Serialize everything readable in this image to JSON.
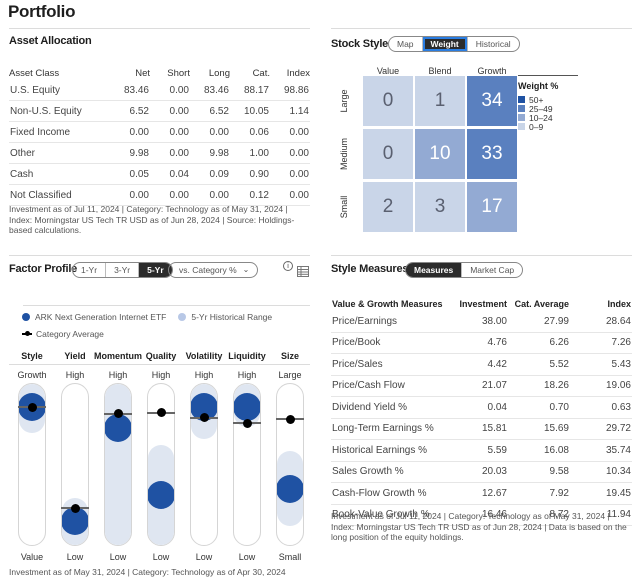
{
  "page_title": "Portfolio",
  "asset_allocation": {
    "title": "Asset Allocation",
    "columns": [
      "Asset Class",
      "Net",
      "Short",
      "Long",
      "Cat.",
      "Index"
    ],
    "rows": [
      [
        "U.S. Equity",
        "83.46",
        "0.00",
        "83.46",
        "88.17",
        "98.86"
      ],
      [
        "Non-U.S. Equity",
        "6.52",
        "0.00",
        "6.52",
        "10.05",
        "1.14"
      ],
      [
        "Fixed Income",
        "0.00",
        "0.00",
        "0.00",
        "0.06",
        "0.00"
      ],
      [
        "Other",
        "9.98",
        "0.00",
        "9.98",
        "1.00",
        "0.00"
      ],
      [
        "Cash",
        "0.05",
        "0.04",
        "0.09",
        "0.90",
        "0.00"
      ],
      [
        "Not Classified",
        "0.00",
        "0.00",
        "0.00",
        "0.12",
        "0.00"
      ]
    ],
    "note": "Investment as of Jul 11, 2024 | Category: Technology as of May 31, 2024 | Index: Morningstar US Tech TR USD as of Jun 28, 2024 | Source: Holdings-based calculations."
  },
  "stock_style": {
    "title": "Stock Style",
    "tabs": [
      "Map",
      "Weight",
      "Historical"
    ],
    "active_tab": "Weight",
    "col_labels": [
      "Value",
      "Blend",
      "Growth"
    ],
    "row_labels": [
      "Large",
      "Medium",
      "Small"
    ],
    "grid": [
      [
        "0",
        "1",
        "34"
      ],
      [
        "0",
        "10",
        "33"
      ],
      [
        "2",
        "3",
        "17"
      ]
    ],
    "legend_title": "Weight %",
    "legend": [
      {
        "label": "50+",
        "color": "#1f52a3"
      },
      {
        "label": "25–49",
        "color": "#5a80bf"
      },
      {
        "label": "10–24",
        "color": "#93aad3"
      },
      {
        "label": "0–9",
        "color": "#c9d5e8"
      }
    ]
  },
  "factor_profile": {
    "title": "Factor Profile",
    "periods": [
      "1-Yr",
      "3-Yr",
      "5-Yr"
    ],
    "active_period": "5-Yr",
    "compare_select": "vs. Category %",
    "legend": {
      "fund": "ARK Next Generation Internet ETF",
      "range": "5-Yr Historical Range",
      "category": "Category Average"
    },
    "factors": [
      {
        "name": "Style",
        "top": "Growth",
        "bottom": "Value",
        "fund_pct": 6,
        "cat_pct": 7,
        "range": [
          0,
          14
        ]
      },
      {
        "name": "Yield",
        "top": "High",
        "bottom": "Low",
        "fund_pct": 92,
        "cat_pct": 83,
        "range": [
          86,
          100
        ]
      },
      {
        "name": "Momentum",
        "top": "High",
        "bottom": "Low",
        "fund_pct": 22,
        "cat_pct": 12,
        "range": [
          0,
          100
        ]
      },
      {
        "name": "Quality",
        "top": "High",
        "bottom": "Low",
        "fund_pct": 72,
        "cat_pct": 11,
        "range": [
          46,
          100
        ]
      },
      {
        "name": "Volatility",
        "top": "High",
        "bottom": "Low",
        "fund_pct": 6,
        "cat_pct": 15,
        "range": [
          0,
          19
        ]
      },
      {
        "name": "Liquidity",
        "top": "High",
        "bottom": "Low",
        "fund_pct": 6,
        "cat_pct": 19,
        "range": [
          0,
          10
        ]
      },
      {
        "name": "Size",
        "top": "Large",
        "bottom": "Small",
        "fund_pct": 68,
        "cat_pct": 16,
        "range": [
          50,
          84
        ]
      }
    ],
    "note": "Investment as of May 31, 2024 | Category: Technology as of Apr 30, 2024"
  },
  "style_measures": {
    "title": "Style Measures",
    "tabs": [
      "Measures",
      "Market Cap"
    ],
    "active_tab": "Measures",
    "columns": [
      "Value & Growth Measures",
      "Investment",
      "Cat. Average",
      "Index"
    ],
    "rows": [
      [
        "Price/Earnings",
        "38.00",
        "27.99",
        "28.64"
      ],
      [
        "Price/Book",
        "4.76",
        "6.26",
        "7.26"
      ],
      [
        "Price/Sales",
        "4.42",
        "5.52",
        "5.43"
      ],
      [
        "Price/Cash Flow",
        "21.07",
        "18.26",
        "19.06"
      ],
      [
        "Dividend Yield %",
        "0.04",
        "0.70",
        "0.63"
      ],
      [
        "Long-Term Earnings %",
        "15.81",
        "15.69",
        "29.72"
      ],
      [
        "Historical Earnings %",
        "5.59",
        "16.08",
        "35.74"
      ],
      [
        "Sales Growth %",
        "20.03",
        "9.58",
        "10.34"
      ],
      [
        "Cash-Flow Growth %",
        "12.67",
        "7.92",
        "19.45"
      ],
      [
        "Book-Value Growth %",
        "16.46",
        "8.72",
        "11.94"
      ]
    ],
    "note": "Investment as of Jul 11, 2024 | Category: Technology as of May 31, 2024 | Index: Morningstar US Tech TR USD as of Jun 28, 2024 | Data is based on the long position of the equity holdings."
  },
  "icons": {
    "info": "info-icon",
    "table": "table-view-icon"
  }
}
